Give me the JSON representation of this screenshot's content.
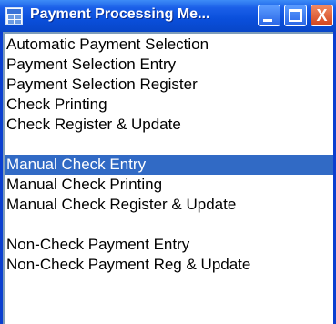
{
  "window": {
    "title": "Payment Processing Me...",
    "controls": {
      "minimize": "minimize",
      "maximize": "maximize",
      "close": "X"
    }
  },
  "menu": {
    "items": [
      {
        "label": "Automatic Payment Selection"
      },
      {
        "label": "Payment Selection Entry"
      },
      {
        "label": "Payment Selection Register"
      },
      {
        "label": "Check Printing"
      },
      {
        "label": "Check Register & Update"
      },
      {
        "label": ""
      },
      {
        "label": "Manual Check Entry",
        "selected": true
      },
      {
        "label": "Manual Check Printing"
      },
      {
        "label": "Manual Check Register & Update"
      },
      {
        "label": ""
      },
      {
        "label": "Non-Check Payment Entry"
      },
      {
        "label": "Non-Check Payment Reg & Update"
      }
    ]
  },
  "colors": {
    "selection": "#316ac5",
    "titlebar": "#0a4fdb"
  }
}
